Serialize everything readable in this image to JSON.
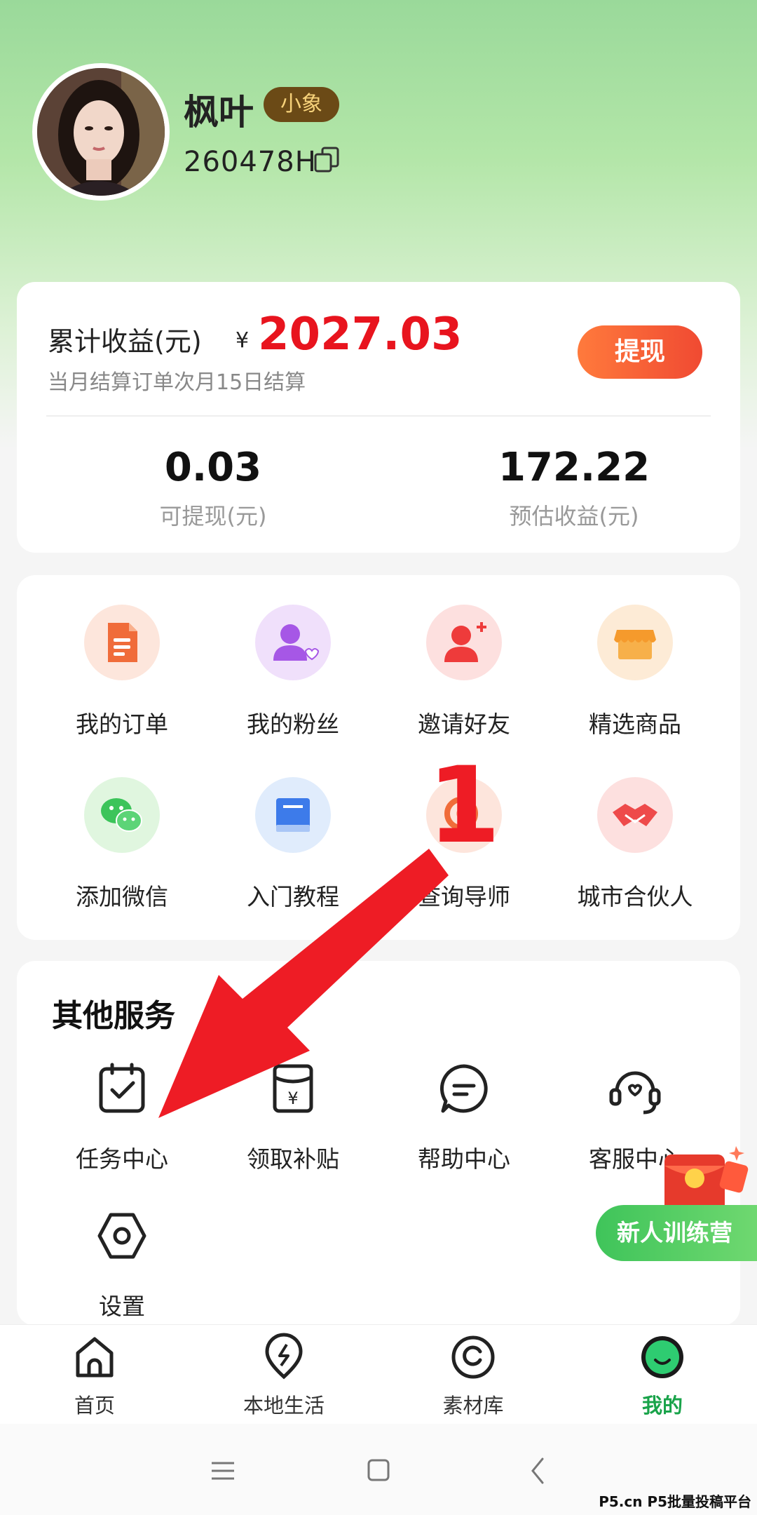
{
  "profile": {
    "username": "枫叶",
    "level_badge": "小象",
    "user_id": "260478H"
  },
  "earnings": {
    "label": "累计收益(元)",
    "currency": "¥",
    "amount": "2027.03",
    "subtitle": "当月结算订单次月15日结算",
    "withdraw_label": "提现",
    "stats": [
      {
        "value": "0.03",
        "label": "可提现(元)"
      },
      {
        "value": "172.22",
        "label": "预估收益(元)"
      }
    ]
  },
  "grid": {
    "items": [
      {
        "label": "我的订单",
        "icon": "order-icon"
      },
      {
        "label": "我的粉丝",
        "icon": "fans-icon"
      },
      {
        "label": "邀请好友",
        "icon": "invite-icon"
      },
      {
        "label": "精选商品",
        "icon": "store-icon"
      },
      {
        "label": "添加微信",
        "icon": "wechat-icon"
      },
      {
        "label": "入门教程",
        "icon": "book-icon"
      },
      {
        "label": "查询导师",
        "icon": "mentor-icon"
      },
      {
        "label": "城市合伙人",
        "icon": "handshake-icon"
      }
    ]
  },
  "services": {
    "title": "其他服务",
    "items": [
      {
        "label": "任务中心",
        "icon": "task-icon"
      },
      {
        "label": "领取补贴",
        "icon": "subsidy-icon"
      },
      {
        "label": "帮助中心",
        "icon": "help-icon"
      },
      {
        "label": "客服中心",
        "icon": "headset-icon"
      },
      {
        "label": "设置",
        "icon": "settings-icon"
      }
    ]
  },
  "floating": {
    "training_label": "新人训练营"
  },
  "annotation": {
    "number": "1",
    "color": "#ee1c25"
  },
  "tabbar": {
    "items": [
      {
        "label": "首页",
        "icon": "home-icon"
      },
      {
        "label": "本地生活",
        "icon": "local-life-icon"
      },
      {
        "label": "素材库",
        "icon": "material-icon"
      },
      {
        "label": "我的",
        "icon": "profile-icon",
        "active": true
      }
    ]
  },
  "watermark": "P5.cn P5批量投稿平台",
  "colors": {
    "accent_red": "#e8141e",
    "active_green": "#19a34a",
    "withdraw_orange": "#f04a32"
  }
}
